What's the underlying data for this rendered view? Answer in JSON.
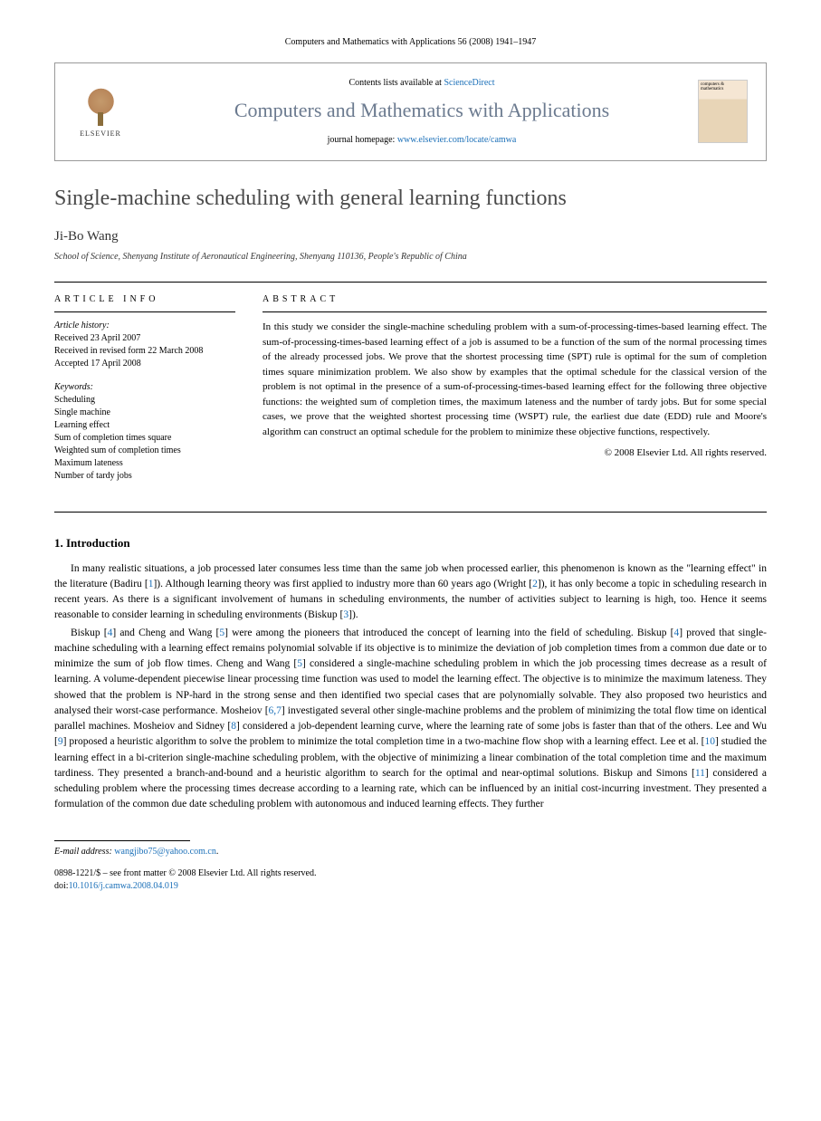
{
  "journal_header": "Computers and Mathematics with Applications 56 (2008) 1941–1947",
  "header": {
    "contents_prefix": "Contents lists available at ",
    "contents_link": "ScienceDirect",
    "journal_name": "Computers and Mathematics with Applications",
    "homepage_prefix": "journal homepage: ",
    "homepage_link": "www.elsevier.com/locate/camwa",
    "publisher": "ELSEVIER",
    "cover_text": "computers & mathematics"
  },
  "title": "Single-machine scheduling with general learning functions",
  "author": "Ji-Bo Wang",
  "affiliation": "School of Science, Shenyang Institute of Aeronautical Engineering, Shenyang 110136, People's Republic of China",
  "article_info": {
    "label": "ARTICLE INFO",
    "history_label": "Article history:",
    "history": [
      "Received 23 April 2007",
      "Received in revised form 22 March 2008",
      "Accepted 17 April 2008"
    ],
    "keywords_label": "Keywords:",
    "keywords": [
      "Scheduling",
      "Single machine",
      "Learning effect",
      "Sum of completion times square",
      "Weighted sum of completion times",
      "Maximum lateness",
      "Number of tardy jobs"
    ]
  },
  "abstract": {
    "label": "ABSTRACT",
    "text": "In this study we consider the single-machine scheduling problem with a sum-of-processing-times-based learning effect. The sum-of-processing-times-based learning effect of a job is assumed to be a function of the sum of the normal processing times of the already processed jobs. We prove that the shortest processing time (SPT) rule is optimal for the sum of completion times square minimization problem. We also show by examples that the optimal schedule for the classical version of the problem is not optimal in the presence of a sum-of-processing-times-based learning effect for the following three objective functions: the weighted sum of completion times, the maximum lateness and the number of tardy jobs. But for some special cases, we prove that the weighted shortest processing time (WSPT) rule, the earliest due date (EDD) rule and Moore's algorithm can construct an optimal schedule for the problem to minimize these objective functions, respectively.",
    "copyright": "© 2008 Elsevier Ltd. All rights reserved."
  },
  "sections": {
    "intro_heading": "1. Introduction",
    "intro_p1": "In many realistic situations, a job processed later consumes less time than the same job when processed earlier, this phenomenon is known as the \"learning effect\" in the literature (Badiru [1]). Although learning theory was first applied to industry more than 60 years ago (Wright [2]), it has only become a topic in scheduling research in recent years. As there is a significant involvement of humans in scheduling environments, the number of activities subject to learning is high, too. Hence it seems reasonable to consider learning in scheduling environments (Biskup [3]).",
    "intro_p2": "Biskup [4] and Cheng and Wang [5] were among the pioneers that introduced the concept of learning into the field of scheduling. Biskup [4] proved that single-machine scheduling with a learning effect remains polynomial solvable if its objective is to minimize the deviation of job completion times from a common due date or to minimize the sum of job flow times. Cheng and Wang [5] considered a single-machine scheduling problem in which the job processing times decrease as a result of learning. A volume-dependent piecewise linear processing time function was used to model the learning effect. The objective is to minimize the maximum lateness. They showed that the problem is NP-hard in the strong sense and then identified two special cases that are polynomially solvable. They also proposed two heuristics and analysed their worst-case performance. Mosheiov [6,7] investigated several other single-machine problems and the problem of minimizing the total flow time on identical parallel machines. Mosheiov and Sidney [8] considered a job-dependent learning curve, where the learning rate of some jobs is faster than that of the others. Lee and Wu [9] proposed a heuristic algorithm to solve the problem to minimize the total completion time in a two-machine flow shop with a learning effect. Lee et al. [10] studied the learning effect in a bi-criterion single-machine scheduling problem, with the objective of minimizing a linear combination of the total completion time and the maximum tardiness. They presented a branch-and-bound and a heuristic algorithm to search for the optimal and near-optimal solutions. Biskup and Simons [11] considered a scheduling problem where the processing times decrease according to a learning rate, which can be influenced by an initial cost-incurring investment. They presented a formulation of the common due date scheduling problem with autonomous and induced learning effects. They further"
  },
  "footer": {
    "email_label": "E-mail address: ",
    "email": "wangjibo75@yahoo.com.cn",
    "issn_line": "0898-1221/$ – see front matter © 2008 Elsevier Ltd. All rights reserved.",
    "doi_prefix": "doi:",
    "doi": "10.1016/j.camwa.2008.04.019"
  },
  "refs": [
    "1",
    "2",
    "3",
    "4",
    "5",
    "6,7",
    "8",
    "9",
    "10",
    "11"
  ]
}
